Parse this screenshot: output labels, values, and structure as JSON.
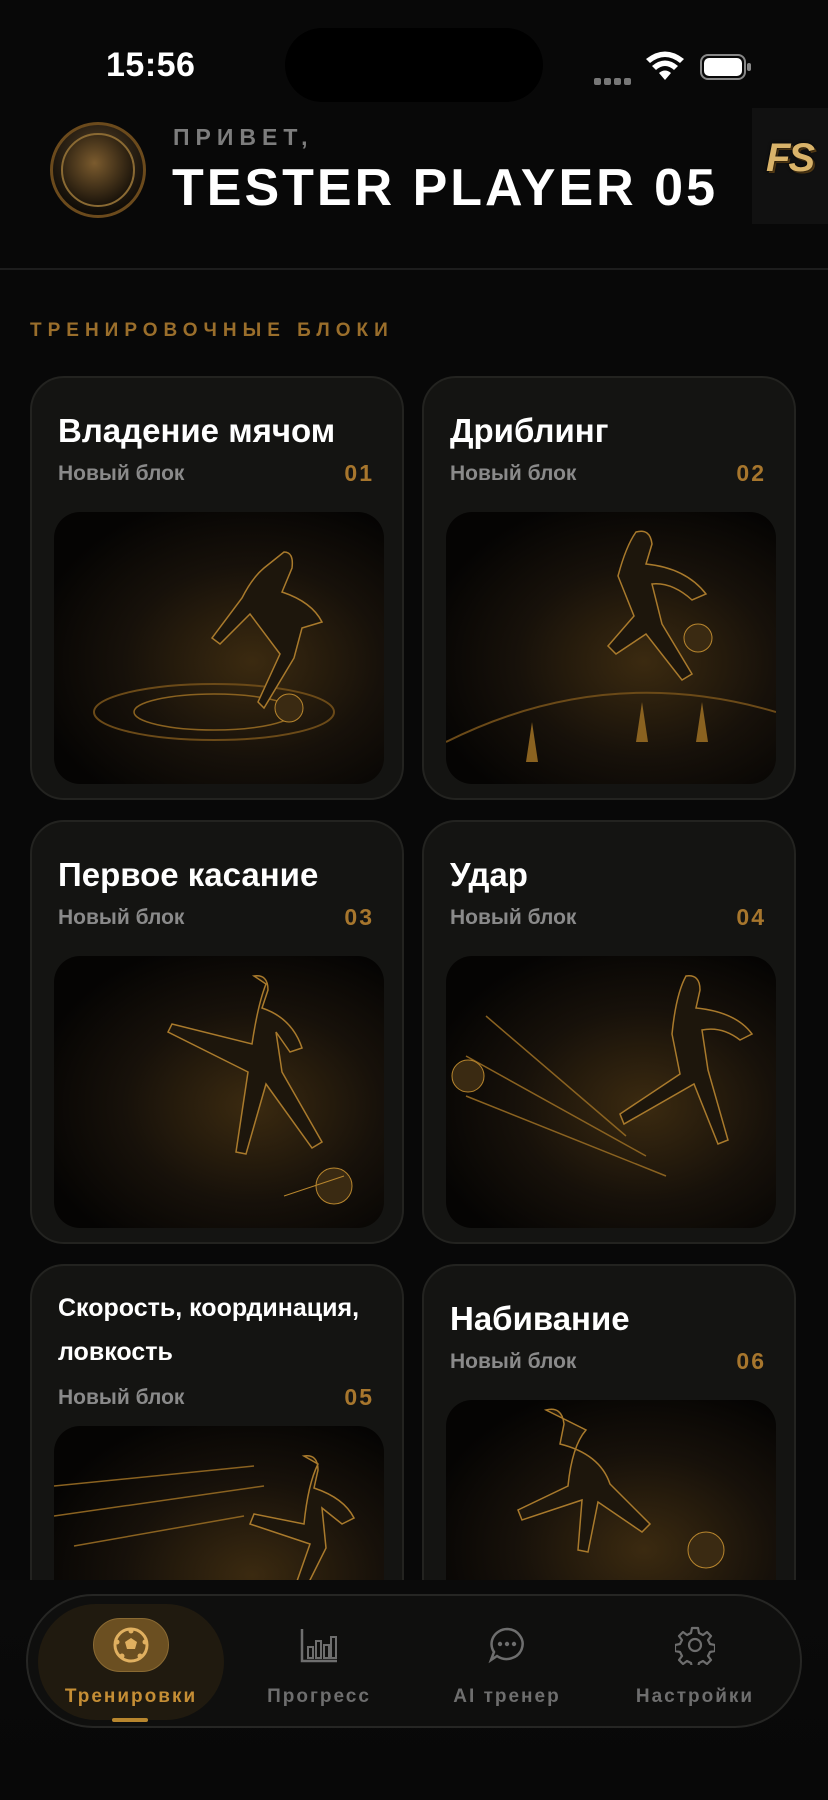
{
  "status_bar": {
    "time": "15:56"
  },
  "header": {
    "greeting": "ПРИВЕТ,",
    "username": "TESTER PLAYER 05",
    "brand_logo": "FS"
  },
  "section_title": "ТРЕНИРОВОЧНЫЕ БЛОКИ",
  "cards": [
    {
      "title": "Владение мячом",
      "subtitle": "Новый блок",
      "number": "01"
    },
    {
      "title": "Дриблинг",
      "subtitle": "Новый блок",
      "number": "02"
    },
    {
      "title": "Первое касание",
      "subtitle": "Новый блок",
      "number": "03"
    },
    {
      "title": "Удар",
      "subtitle": "Новый блок",
      "number": "04"
    },
    {
      "title": "Скорость, координация, ловкость",
      "subtitle": "Новый блок",
      "number": "05"
    },
    {
      "title": "Набивание",
      "subtitle": "Новый блок",
      "number": "06"
    }
  ],
  "tabs": [
    {
      "label": "Тренировки",
      "icon": "soccer-ball-icon",
      "active": true
    },
    {
      "label": "Прогресс",
      "icon": "bar-chart-icon",
      "active": false
    },
    {
      "label": "AI тренер",
      "icon": "chat-bubble-icon",
      "active": false
    },
    {
      "label": "Настройки",
      "icon": "gear-icon",
      "active": false
    }
  ],
  "colors": {
    "accent": "#c58e35",
    "background": "#080808",
    "card": "#141412"
  }
}
